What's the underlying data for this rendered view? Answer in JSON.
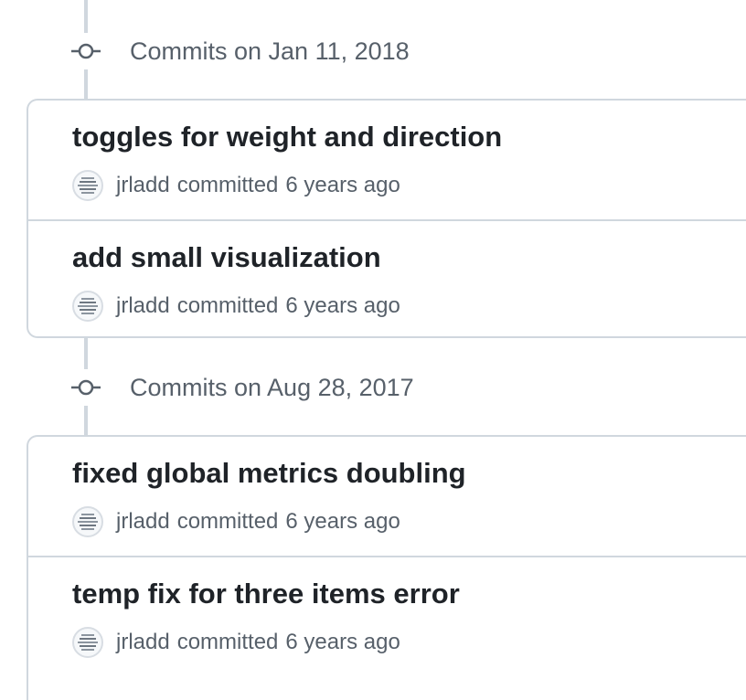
{
  "groups": [
    {
      "title": "Commits on Jan 11, 2018",
      "commits": [
        {
          "message": "toggles for weight and direction",
          "author": "jrladd",
          "verb": "committed",
          "time": "6 years ago"
        },
        {
          "message": "add small visualization",
          "author": "jrladd",
          "verb": "committed",
          "time": "6 years ago"
        }
      ]
    },
    {
      "title": "Commits on Aug 28, 2017",
      "commits": [
        {
          "message": "fixed global metrics doubling",
          "author": "jrladd",
          "verb": "committed",
          "time": "6 years ago"
        },
        {
          "message": "temp fix for three items error",
          "author": "jrladd",
          "verb": "committed",
          "time": "6 years ago"
        }
      ]
    }
  ],
  "colors": {
    "border": "#d0d7de",
    "muted_text": "#57606a",
    "title_text": "#1f2328"
  },
  "icons": {
    "group_marker": "git-commit-icon",
    "avatar": "avatar-image"
  }
}
